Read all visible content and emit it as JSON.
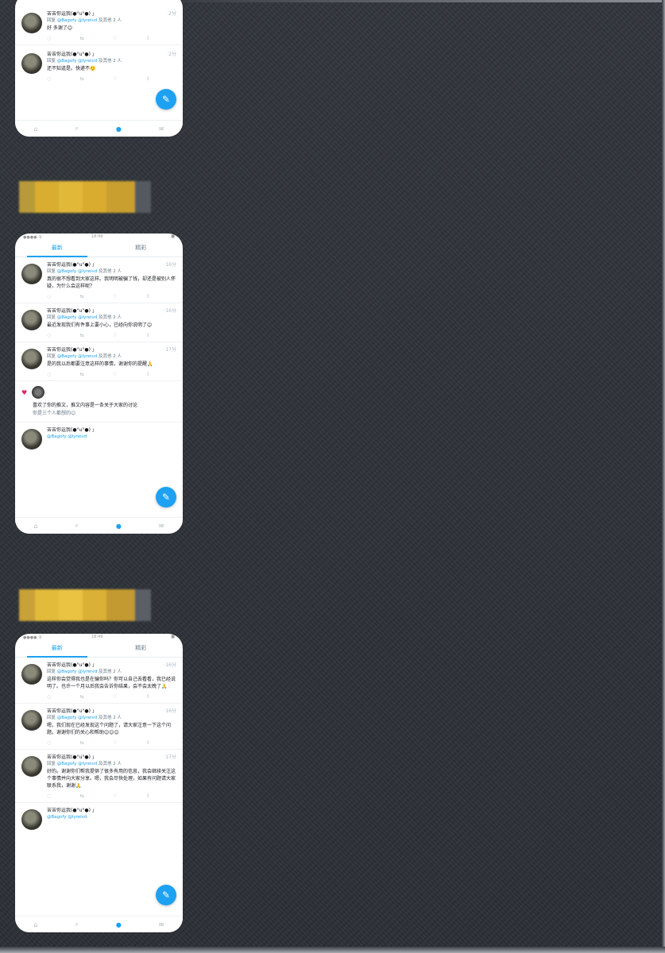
{
  "screens": [
    {
      "status": {
        "left": "",
        "center": "",
        "right": ""
      },
      "tabs": [],
      "tweets": [
        {
          "name": "苦苦你逗我(●°u°●)​ 」",
          "time": "·2分",
          "reply_prefix": "回复",
          "handles": "@Bagofy @lyreivd",
          "reply_suffix": "及其他 2 人",
          "text": "好 多谢了😊"
        },
        {
          "name": "苦苦你逗我(●°u°●)​ 」",
          "time": "·2分",
          "reply_prefix": "回复",
          "handles": "@Bagofy @lyreivd",
          "reply_suffix": "及其他 2 人",
          "text": "还不知道是。快递不🙂"
        }
      ]
    },
    {
      "status": {
        "left": "●●●● 令",
        "center": "18:49",
        "right": "■"
      },
      "tabs": [
        "最新",
        "精彩"
      ],
      "tweets": [
        {
          "name": "苦苦你逗我(●°u°●)​ 」",
          "time": "·16分",
          "reply_prefix": "回复",
          "handles": "@Bagofy @lyreivd",
          "reply_suffix": "及其他 2 人",
          "text": "真的很不想看到大家这样。我明明被骗了钱，却还是被别人怀疑，为什么会这样呢？"
        },
        {
          "name": "苦苦你逗我(●°u°●)​ 」",
          "time": "·16分",
          "reply_prefix": "回复",
          "handles": "@Bagofy @lyreivd",
          "reply_suffix": "及其他 2 人",
          "text": "最近发现我们有件事上要小心，已经向你说明了😊"
        },
        {
          "name": "苦苦你逗我(●°u°●)​ 」",
          "time": "·17分",
          "reply_prefix": "回复",
          "handles": "@Bagofy @lyreivd",
          "reply_suffix": "及其他 2 人",
          "text": "是的我以后都要注意这样的事情，谢谢你的提醒🙏"
        }
      ],
      "liked": {
        "text": "喜欢了你的推文，推文内容是一条关于大家的讨论",
        "sub": "你是三个人都想的😊"
      },
      "last_tweet": {
        "name": "苦苦你逗我(●°u°●)​ 」",
        "handles": "@Bagofy @lyreivd"
      }
    },
    {
      "status": {
        "left": "●●●● 令",
        "center": "18:49",
        "right": "■"
      },
      "tabs": [
        "最新",
        "精彩"
      ],
      "tweets": [
        {
          "name": "苦苦你逗我(●°u°●)​ 」",
          "time": "·16分",
          "reply_prefix": "回复",
          "handles": "@Bagofy @lyreivd",
          "reply_suffix": "及其他 2 人",
          "text": "这样你会觉得我也是在骗你吗？你可以自己去看看，我已经说明了。也许一个月以后我会告诉你结果，会不会太晚了🙏"
        },
        {
          "name": "苦苦你逗我(●°u°●)​ 」",
          "time": "·16分",
          "reply_prefix": "回复",
          "handles": "@Bagofy @lyreivd",
          "reply_suffix": "及其他 2 人",
          "text": "嗯，我们现在已经发现这个问题了，请大家注意一下这个问题。谢谢你们的关心和帮助😊😊😊"
        },
        {
          "name": "苦苦你逗我(●°u°●)​ 」",
          "time": "·17分",
          "reply_prefix": "回复",
          "handles": "@Bagofy @lyreivd",
          "reply_suffix": "及其他 2 人",
          "text": "好的。谢谢你们帮我提供了很多有用的信息，我会继续关注这个事情并向大家分享。嗯，我会尽快处理，如果有问题请大家联系我，谢谢🙏"
        }
      ],
      "last_tweet": {
        "name": "苦苦你逗我(●°u°●)​ 」",
        "handles": "@Bagofy @lyreivd"
      }
    }
  ],
  "icons": {
    "reply": "reply-icon",
    "retweet": "retweet-icon",
    "like": "heart-icon",
    "share": "share-icon",
    "nav_home": "home-icon",
    "nav_search": "search-icon",
    "nav_notify": "bell-icon",
    "nav_mail": "mail-icon",
    "compose": "compose-icon"
  },
  "colors": {
    "accent": "#1da1f2",
    "background": "#2c3036",
    "redaction": "#d4a72c"
  }
}
